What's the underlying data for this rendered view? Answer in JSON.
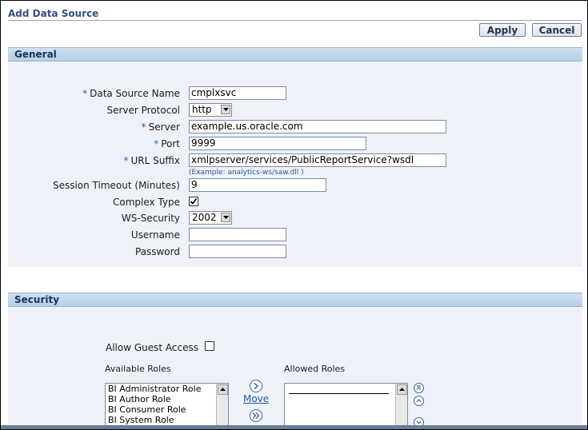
{
  "page": {
    "title": "Add Data Source"
  },
  "toolbar": {
    "apply_label": "Apply",
    "cancel_label": "Cancel"
  },
  "general": {
    "header": "General",
    "fields": {
      "data_source_name": {
        "label": "Data Source Name",
        "required": "*",
        "value": "cmplxsvc"
      },
      "server_protocol": {
        "label": "Server Protocol",
        "value": "http"
      },
      "server": {
        "label": "Server",
        "required": "*",
        "value": "example.us.oracle.com"
      },
      "port": {
        "label": "Port",
        "required": "*",
        "value": "9999"
      },
      "url_suffix": {
        "label": "URL Suffix",
        "required": "*",
        "value": "xmlpserver/services/PublicReportService?wsdl",
        "hint": "(Example: analytics-ws/saw.dll )"
      },
      "session_timeout": {
        "label": "Session Timeout (Minutes)",
        "value": "9"
      },
      "complex_type": {
        "label": "Complex Type",
        "checked": true
      },
      "ws_security": {
        "label": "WS-Security",
        "value": "2002"
      },
      "username": {
        "label": "Username",
        "value": ""
      },
      "password": {
        "label": "Password",
        "value": ""
      }
    }
  },
  "security": {
    "header": "Security",
    "allow_guest_access": {
      "label": "Allow Guest Access",
      "checked": false
    },
    "available_roles": {
      "label": "Available Roles",
      "items": [
        "BI Administrator Role",
        "BI Author Role",
        "BI Consumer Role",
        "BI System Role"
      ]
    },
    "allowed_roles": {
      "label": "Allowed Roles",
      "items": []
    },
    "move_label": "Move",
    "move_all_label": "Move All"
  },
  "colors": {
    "section_bg": "#eef2f8",
    "header_bg": "#b6cfe8",
    "link": "#2b56a3",
    "title": "#35507a"
  }
}
